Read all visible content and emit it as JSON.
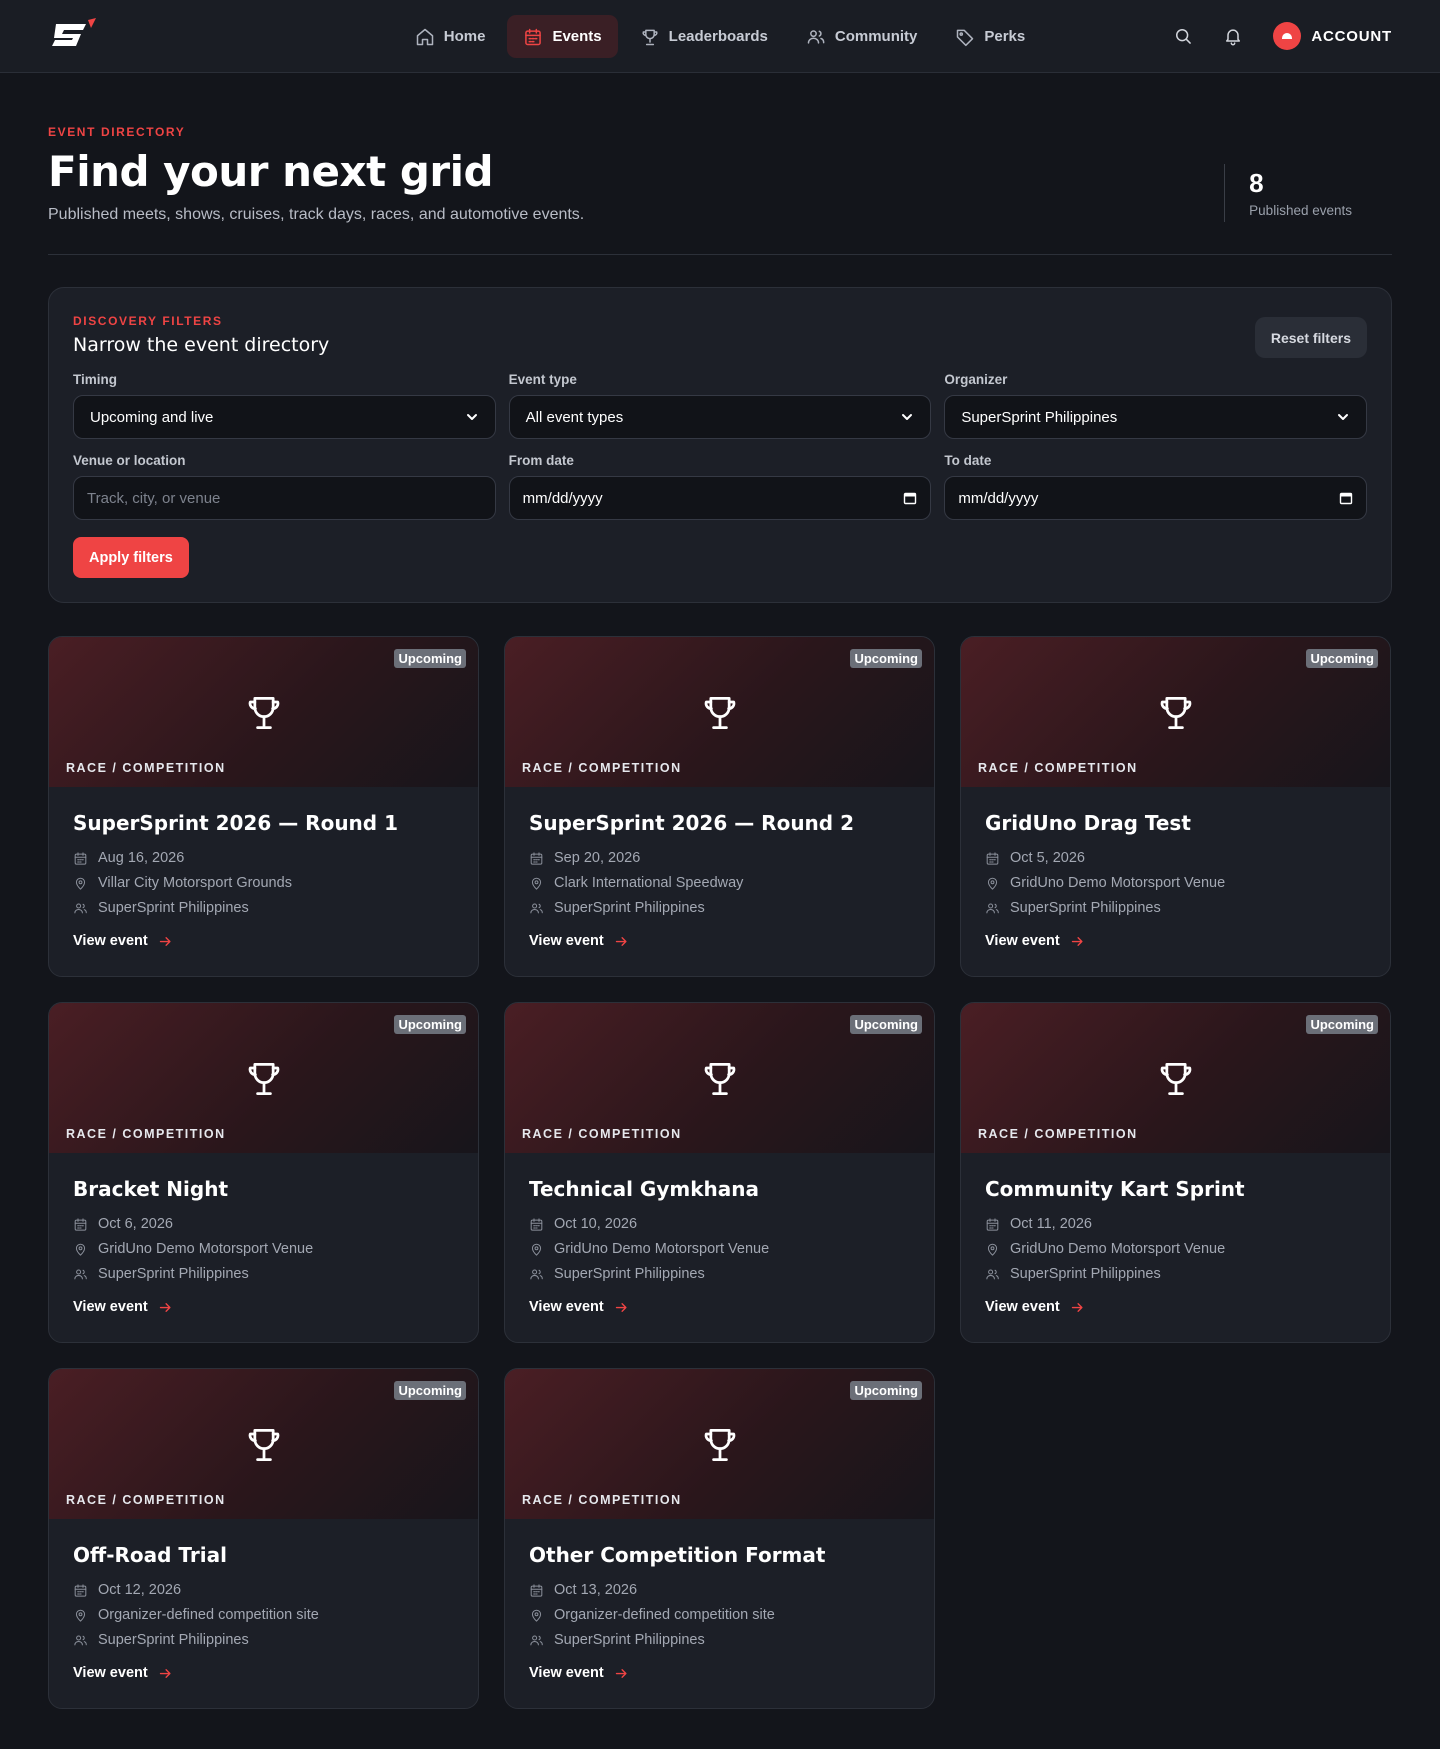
{
  "nav": {
    "items": [
      {
        "label": "Home",
        "icon": "home-icon"
      },
      {
        "label": "Events",
        "icon": "calendar-icon",
        "active": true
      },
      {
        "label": "Leaderboards",
        "icon": "trophy-icon"
      },
      {
        "label": "Community",
        "icon": "users-icon"
      },
      {
        "label": "Perks",
        "icon": "tag-icon"
      }
    ],
    "account_label": "ACCOUNT"
  },
  "header": {
    "eyebrow": "EVENT DIRECTORY",
    "title": "Find your next grid",
    "subtitle": "Published meets, shows, cruises, track days, races, and automotive events.",
    "stat_value": "8",
    "stat_label": "Published events"
  },
  "filters": {
    "eyebrow": "DISCOVERY FILTERS",
    "title": "Narrow the event directory",
    "reset_label": "Reset filters",
    "timing": {
      "label": "Timing",
      "value": "Upcoming and live"
    },
    "event_type": {
      "label": "Event type",
      "value": "All event types"
    },
    "organizer": {
      "label": "Organizer",
      "value": "SuperSprint Philippines"
    },
    "venue": {
      "label": "Venue or location",
      "placeholder": "Track, city, or venue"
    },
    "from_date": {
      "label": "From date",
      "value": "mm/dd/yyyy"
    },
    "to_date": {
      "label": "To date",
      "value": "mm/dd/yyyy"
    },
    "apply_label": "Apply filters"
  },
  "cards": [
    {
      "badge": "Upcoming",
      "category": "RACE / COMPETITION",
      "title": "SuperSprint 2026 — Round 1",
      "date": "Aug 16, 2026",
      "venue": "Villar City Motorsport Grounds",
      "organizer": "SuperSprint Philippines",
      "link": "View event"
    },
    {
      "badge": "Upcoming",
      "category": "RACE / COMPETITION",
      "title": "SuperSprint 2026 — Round 2",
      "date": "Sep 20, 2026",
      "venue": "Clark International Speedway",
      "organizer": "SuperSprint Philippines",
      "link": "View event"
    },
    {
      "badge": "Upcoming",
      "category": "RACE / COMPETITION",
      "title": "GridUno Drag Test",
      "date": "Oct 5, 2026",
      "venue": "GridUno Demo Motorsport Venue",
      "organizer": "SuperSprint Philippines",
      "link": "View event"
    },
    {
      "badge": "Upcoming",
      "category": "RACE / COMPETITION",
      "title": "Bracket Night",
      "date": "Oct 6, 2026",
      "venue": "GridUno Demo Motorsport Venue",
      "organizer": "SuperSprint Philippines",
      "link": "View event"
    },
    {
      "badge": "Upcoming",
      "category": "RACE / COMPETITION",
      "title": "Technical Gymkhana",
      "date": "Oct 10, 2026",
      "venue": "GridUno Demo Motorsport Venue",
      "organizer": "SuperSprint Philippines",
      "link": "View event"
    },
    {
      "badge": "Upcoming",
      "category": "RACE / COMPETITION",
      "title": "Community Kart Sprint",
      "date": "Oct 11, 2026",
      "venue": "GridUno Demo Motorsport Venue",
      "organizer": "SuperSprint Philippines",
      "link": "View event"
    },
    {
      "badge": "Upcoming",
      "category": "RACE / COMPETITION",
      "title": "Off-Road Trial",
      "date": "Oct 12, 2026",
      "venue": "Organizer-defined competition site",
      "organizer": "SuperSprint Philippines",
      "link": "View event"
    },
    {
      "badge": "Upcoming",
      "category": "RACE / COMPETITION",
      "title": "Other Competition Format",
      "date": "Oct 13, 2026",
      "venue": "Organizer-defined competition site",
      "organizer": "SuperSprint Philippines",
      "link": "View event"
    }
  ],
  "colors": {
    "accent": "#ef4444",
    "background": "#13151b",
    "surface": "#1c1f27"
  }
}
